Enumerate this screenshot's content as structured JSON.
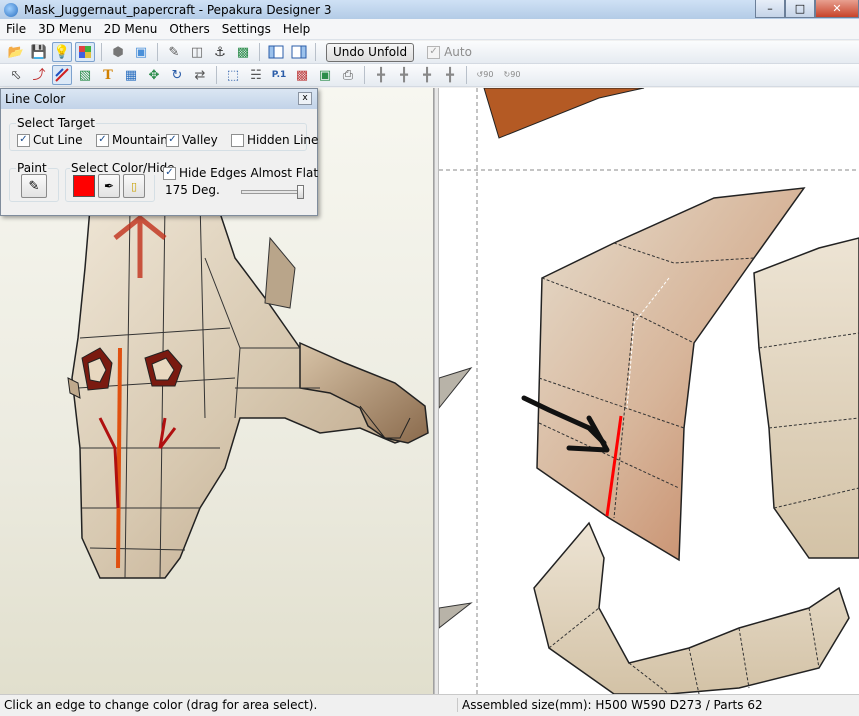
{
  "window": {
    "title": "Mask_Juggernaut_papercraft - Pepakura Designer 3",
    "minimize": "–",
    "maximize": "□",
    "close": "✕"
  },
  "menu": [
    "File",
    "3D Menu",
    "2D Menu",
    "Others",
    "Settings",
    "Help"
  ],
  "toolbar": {
    "undo_unfold_label": "Undo Unfold",
    "auto_label": "Auto",
    "auto_checked": true,
    "icons_row1": [
      "open-icon",
      "save-icon",
      "light-icon",
      "texture-icon",
      "cube-icon",
      "box-icon",
      "pencil-icon",
      "cylinder-icon",
      "anchor-icon",
      "piece-icon",
      "view-left-icon",
      "view-right-icon"
    ],
    "icons_row2": [
      "select-icon",
      "join-icon",
      "edge-color-icon",
      "glue-icon",
      "text-icon",
      "image-icon",
      "move-icon",
      "rotate-icon",
      "flip-icon",
      "arrange-icon",
      "align-icon",
      "page-icon",
      "chart-icon",
      "print-preview-icon",
      "print-icon",
      "center-h-icon",
      "center-v-icon",
      "rotate-90-ccw-icon",
      "rotate-90-cw-icon"
    ],
    "rotate_label": "90"
  },
  "line_color_panel": {
    "title": "Line Color",
    "close": "x",
    "select_target_label": "Select Target",
    "targets": [
      {
        "label": "Cut Line",
        "checked": true
      },
      {
        "label": "Mountain",
        "checked": true
      },
      {
        "label": "Valley",
        "checked": true
      },
      {
        "label": "Hidden Line",
        "checked": false
      }
    ],
    "paint_label": "Paint",
    "select_color_label": "Select Color/Hide",
    "selected_color": "#ff0000",
    "hide_edges_label": "Hide Edges Almost Flat",
    "hide_edges_checked": true,
    "angle_label": "175 Deg.",
    "angle_slider_fraction": 0.97
  },
  "status": {
    "hint": "Click an edge to change color (drag for area select).",
    "assembled": "Assembled size(mm): H500 W590 D273 / Parts 62"
  },
  "colors": {
    "highlight_edge": "#ff0000",
    "mask_base": "#d9cdb9",
    "mask_blush": "#c98662",
    "rust_piece": "#b45a24"
  }
}
